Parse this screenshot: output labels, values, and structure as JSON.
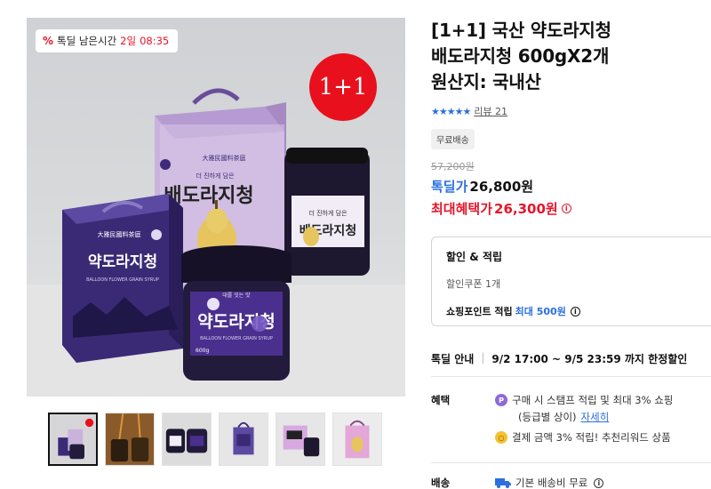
{
  "promo": {
    "timer_prefix": "톡딜 남은시간",
    "timer_days": "2일",
    "timer_time": "08:35",
    "percent_icon": "percent-icon",
    "badge_text": "1+1"
  },
  "product_image": {
    "large_box_brand": "大雅民國料茶庭",
    "large_box_tagline": "더 진하게 담은",
    "large_box_name": "배도라지청",
    "front_jar_tagline": "대를 잇는 맛",
    "front_jar_name": "약도라지청",
    "front_jar_sub": "BALLOON FLOWER GRAIN SYRUP",
    "left_box_brand": "大雅民國料茶庭",
    "left_box_name": "약도라지청",
    "left_box_sub": "BALLOON FLOWER GRAIN SYRUP",
    "jar_weight": "600g"
  },
  "thumbnails": [
    {
      "label": "thumbnail-1",
      "active": true
    },
    {
      "label": "thumbnail-2",
      "active": false
    },
    {
      "label": "thumbnail-3",
      "active": false
    },
    {
      "label": "thumbnail-4",
      "active": false
    },
    {
      "label": "thumbnail-5",
      "active": false
    },
    {
      "label": "thumbnail-6",
      "active": false
    }
  ],
  "product": {
    "title": "[1+1] 국산 약도라지청\n배도라지청 600gX2개\n원산지: 국내산",
    "stars": "★★★★★",
    "review_label": "리뷰 21",
    "free_shipping_badge": "무료배송",
    "original_price": "57,200원",
    "deal_label": "톡딜가",
    "deal_price": "26,800원",
    "max_label": "최대혜택가",
    "max_price": "26,300원"
  },
  "discount": {
    "heading": "할인 & 적립",
    "coupon": "할인쿠폰 1개",
    "points_label": "쇼핑포인트 적립",
    "points_value": "최대 500원"
  },
  "deal_info": {
    "label": "톡딜 안내",
    "value": "9/2 17:00 ~ 9/5 23:59 까지 한정할인"
  },
  "benefit": {
    "label": "혜택",
    "line1": "구매 시 스탬프 적립 및 최대 3% 쇼핑",
    "line2_prefix": "(등급별 상이)",
    "line2_link": "자세히",
    "line3": "결제 금액 3% 적립! 추천리워드 상품"
  },
  "shipping": {
    "label": "배송",
    "value": "기본 배송비 무료"
  },
  "colors": {
    "accent_blue": "#2b6fe0",
    "accent_red": "#e4162b",
    "promo_red": "#e8101c"
  }
}
